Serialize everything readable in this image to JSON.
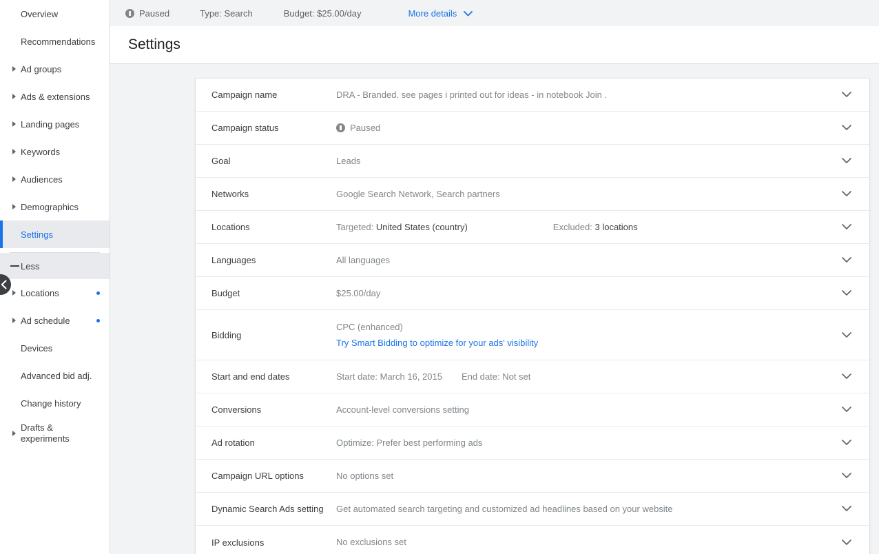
{
  "statusbar": {
    "status_icon": "pause-circle-icon",
    "status_label": "Paused",
    "type_label": "Type: Search",
    "budget_label": "Budget: $25.00/day",
    "more_details_label": "More details",
    "more_details_icon": "chevron-down-icon",
    "link_color": "#1a73e8"
  },
  "page": {
    "title": "Settings"
  },
  "sidebar": {
    "selected_color": "#1a73e8",
    "less_label": "Less",
    "less_icon": "minus-icon",
    "collapse_icon": "chevron-left-icon",
    "items": [
      {
        "label": "Overview",
        "expandable": false,
        "selected": false,
        "dot": false
      },
      {
        "label": "Recommendations",
        "expandable": false,
        "selected": false,
        "dot": false
      },
      {
        "label": "Ad groups",
        "expandable": true,
        "selected": false,
        "dot": false
      },
      {
        "label": "Ads & extensions",
        "expandable": true,
        "selected": false,
        "dot": false
      },
      {
        "label": "Landing pages",
        "expandable": true,
        "selected": false,
        "dot": false
      },
      {
        "label": "Keywords",
        "expandable": true,
        "selected": false,
        "dot": false
      },
      {
        "label": "Audiences",
        "expandable": true,
        "selected": false,
        "dot": false
      },
      {
        "label": "Demographics",
        "expandable": true,
        "selected": false,
        "dot": false
      },
      {
        "label": "Settings",
        "expandable": false,
        "selected": true,
        "dot": false
      }
    ],
    "sub_items": [
      {
        "label": "Locations",
        "expandable": true,
        "dot": true
      },
      {
        "label": "Ad schedule",
        "expandable": true,
        "dot": true
      },
      {
        "label": "Devices",
        "expandable": false,
        "dot": false
      },
      {
        "label": "Advanced bid adj.",
        "expandable": false,
        "dot": false
      },
      {
        "label": "Change history",
        "expandable": false,
        "dot": false
      },
      {
        "label": "Drafts & experiments",
        "expandable": true,
        "dot": false
      }
    ]
  },
  "settings_rows": [
    {
      "label": "Campaign name",
      "value": "DRA - Branded. see pages i printed out for ideas - in notebook Join ."
    },
    {
      "label": "Campaign status",
      "status_icon": "pause-circle-icon",
      "value": "Paused"
    },
    {
      "label": "Goal",
      "value": "Leads"
    },
    {
      "label": "Networks",
      "value": "Google Search Network, Search partners"
    },
    {
      "label": "Locations",
      "targeted_prefix": "Targeted: ",
      "targeted_value": "United States (country)",
      "excluded_prefix": "Excluded: ",
      "excluded_value": "3 locations"
    },
    {
      "label": "Languages",
      "value": "All languages"
    },
    {
      "label": "Budget",
      "value": "$25.00/day"
    },
    {
      "label": "Bidding",
      "line1": "CPC (enhanced)",
      "line2": "Try Smart Bidding to optimize for your ads' visibility"
    },
    {
      "label": "Start and end dates",
      "start": "Start date: March 16, 2015",
      "end": "End date: Not set"
    },
    {
      "label": "Conversions",
      "value": "Account-level conversions setting"
    },
    {
      "label": "Ad rotation",
      "value": "Optimize: Prefer best performing ads"
    },
    {
      "label": "Campaign URL options",
      "value": "No options set"
    },
    {
      "label": "Dynamic Search Ads setting",
      "value": "Get automated search targeting and customized ad headlines based on your website"
    },
    {
      "label": "IP exclusions",
      "value": "No exclusions set"
    }
  ]
}
